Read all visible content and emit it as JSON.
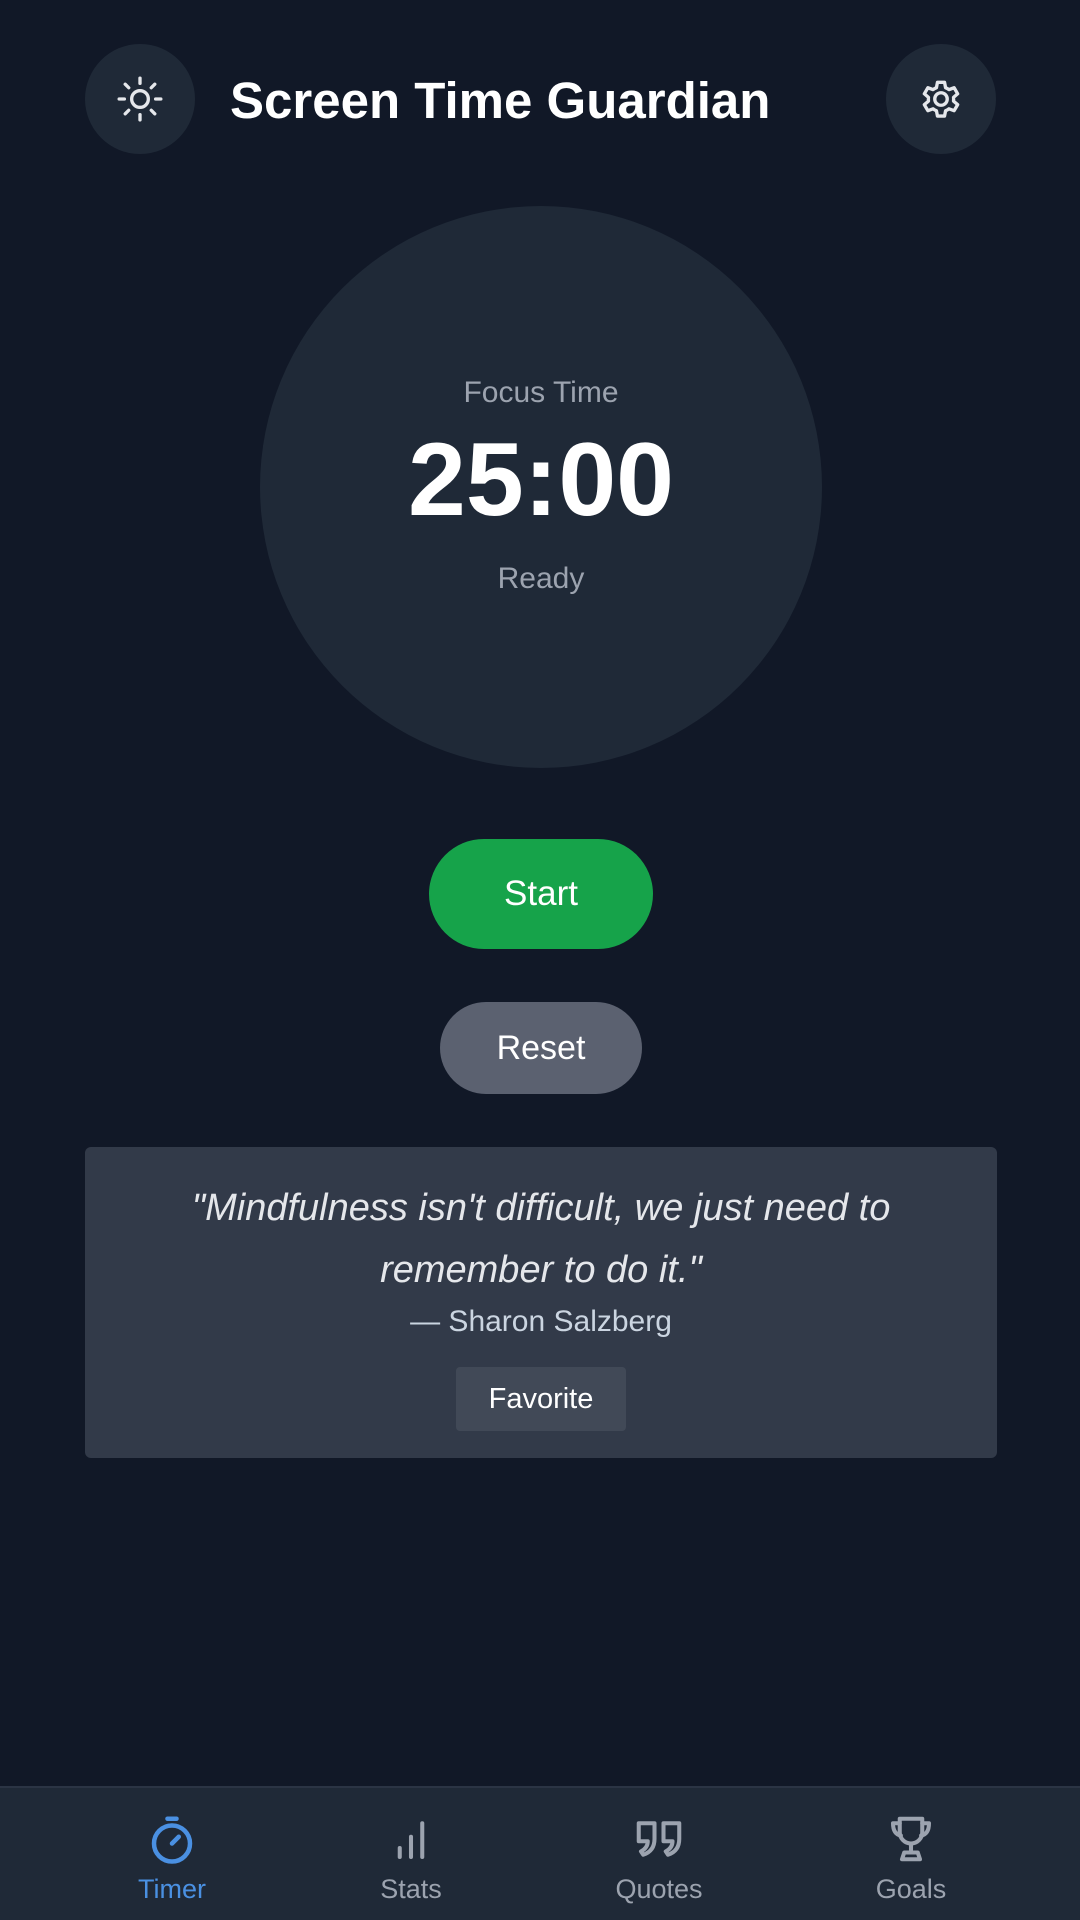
{
  "header": {
    "title": "Screen Time Guardian",
    "theme_icon": "sun-icon",
    "settings_icon": "gear-icon"
  },
  "timer": {
    "label": "Focus Time",
    "value": "25:00",
    "status": "Ready"
  },
  "controls": {
    "start_label": "Start",
    "reset_label": "Reset"
  },
  "quote": {
    "text": "\"Mindfulness isn't difficult, we just need to remember to do it.\"",
    "author": "— Sharon Salzberg",
    "favorite_label": "Favorite"
  },
  "nav": {
    "items": [
      {
        "label": "Timer",
        "icon": "stopwatch-icon",
        "active": true
      },
      {
        "label": "Stats",
        "icon": "bar-chart-icon",
        "active": false
      },
      {
        "label": "Quotes",
        "icon": "quote-icon",
        "active": false
      },
      {
        "label": "Goals",
        "icon": "trophy-icon",
        "active": false
      }
    ]
  },
  "colors": {
    "background": "#111827",
    "surface": "#1f2937",
    "card": "#323a49",
    "start": "#16a34a",
    "reset": "#5b6170",
    "accent": "#4a90e2",
    "muted": "#9ca3af"
  }
}
